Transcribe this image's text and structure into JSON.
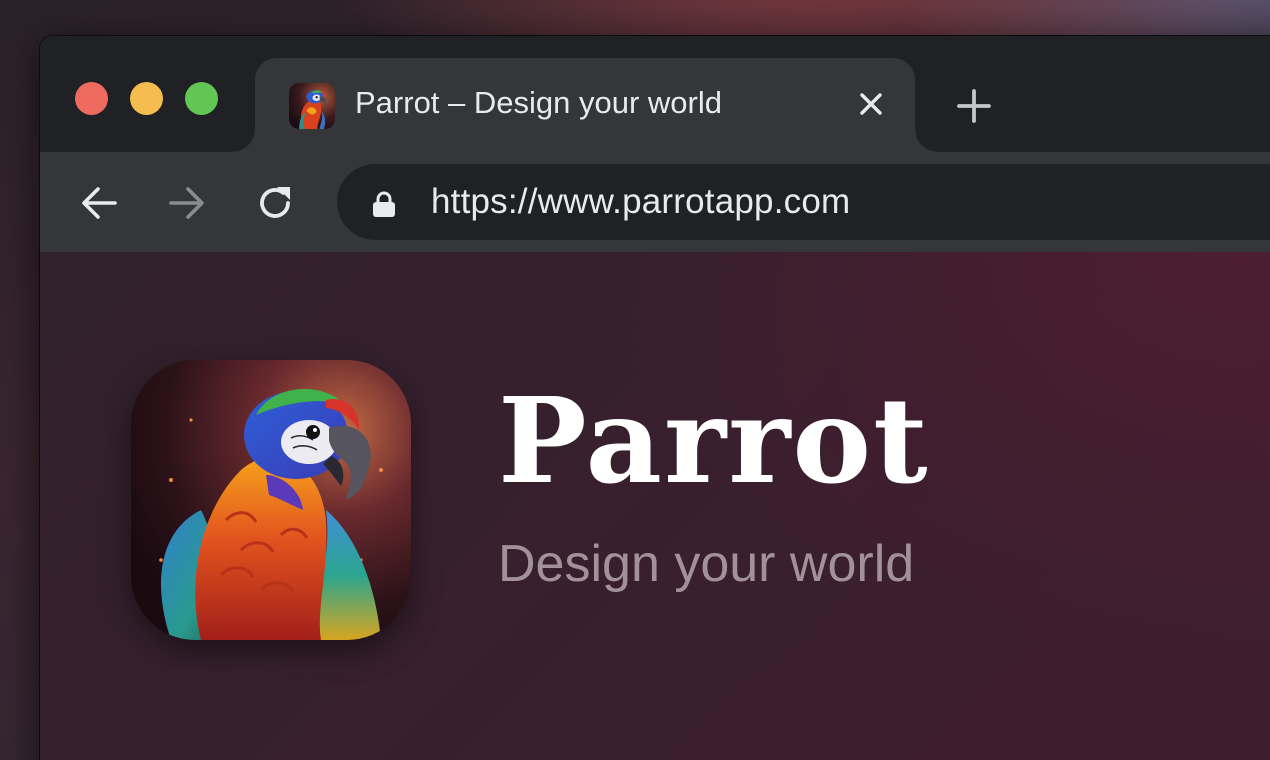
{
  "window_controls": {
    "close": "close-window",
    "minimize": "minimize-window",
    "zoom": "zoom-window"
  },
  "tab": {
    "title": "Parrot – Design your world",
    "favicon": "parrot-icon",
    "close_icon": "close-icon"
  },
  "new_tab_icon": "plus-icon",
  "toolbar": {
    "back_icon": "arrow-left-icon",
    "forward_icon": "arrow-right-icon",
    "reload_icon": "reload-icon",
    "lock_icon": "lock-icon",
    "url": "https://www.parrotapp.com"
  },
  "hero": {
    "brand_name": "Parrot",
    "tagline": "Design your world",
    "app_icon": "parrot-icon"
  },
  "colors": {
    "traffic_red": "#ee6a5f",
    "traffic_yellow": "#f5bd4f",
    "traffic_green": "#62c655",
    "tab_bg": "#35363a",
    "frame_bg": "#202124",
    "text_primary": "#e8eaed",
    "tagline": "#a29199"
  }
}
